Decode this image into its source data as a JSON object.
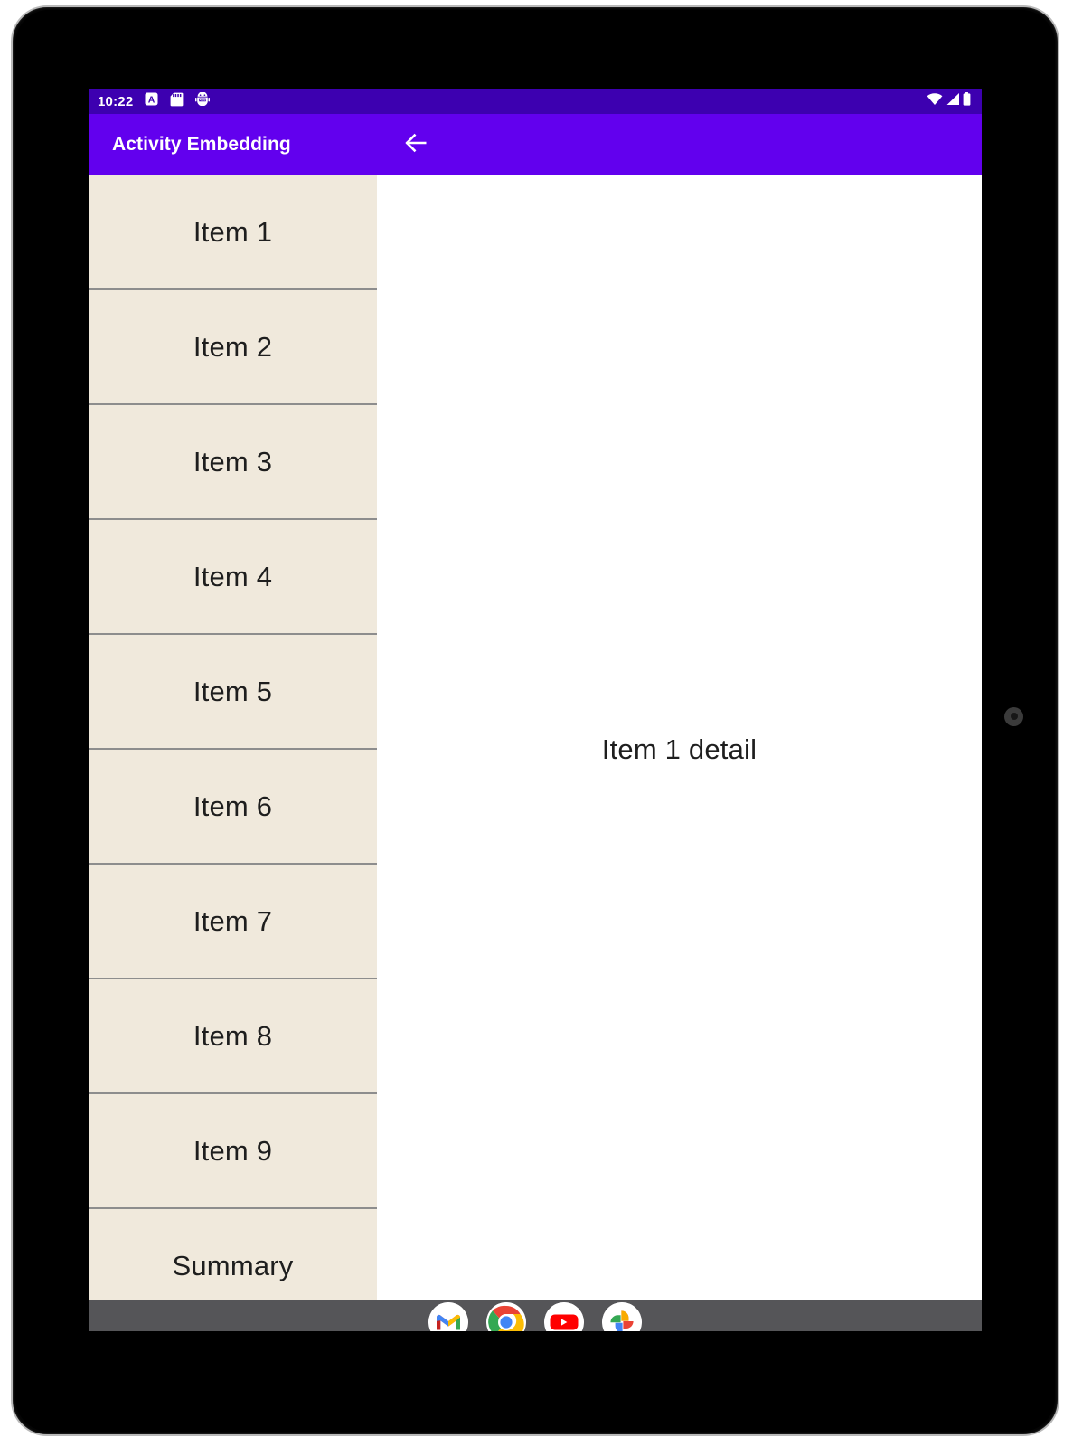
{
  "device": {
    "type": "android-tablet",
    "camera_icon": "front-camera-dot"
  },
  "status_bar": {
    "clock": "10:22",
    "background_color": "#3d00b0",
    "left_icons": [
      "a-badge-icon",
      "sd-card-icon",
      "android-debug-icon"
    ],
    "right_icons": [
      "wifi-icon",
      "cellular-signal-icon",
      "battery-icon"
    ]
  },
  "app_bar": {
    "title": "Activity Embedding",
    "background_color": "#6200ee",
    "back_icon": "arrow-left-icon"
  },
  "list_pane": {
    "background_color": "#f0e9dc",
    "divider_color": "#8d8d8d",
    "items": [
      {
        "label": "Item 1"
      },
      {
        "label": "Item 2"
      },
      {
        "label": "Item 3"
      },
      {
        "label": "Item 4"
      },
      {
        "label": "Item 5"
      },
      {
        "label": "Item 6"
      },
      {
        "label": "Item 7"
      },
      {
        "label": "Item 8"
      },
      {
        "label": "Item 9"
      },
      {
        "label": "Summary"
      }
    ]
  },
  "detail_pane": {
    "text": "Item 1 detail",
    "background_color": "#ffffff"
  },
  "taskbar": {
    "background_color": "#555558",
    "apps": [
      {
        "name": "gmail-app-icon",
        "label": "Gmail"
      },
      {
        "name": "chrome-app-icon",
        "label": "Chrome"
      },
      {
        "name": "youtube-app-icon",
        "label": "YouTube"
      },
      {
        "name": "photos-app-icon",
        "label": "Photos"
      }
    ]
  }
}
